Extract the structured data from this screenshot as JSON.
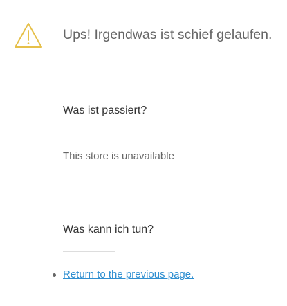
{
  "header": {
    "icon": "warning-icon",
    "title": "Ups! Irgendwas ist schief gelaufen."
  },
  "what_happened": {
    "heading": "Was ist passiert?",
    "text": "This store is unavailable"
  },
  "what_to_do": {
    "heading": "Was kann ich tun?",
    "actions": [
      {
        "label": "Return to the previous page."
      }
    ]
  },
  "colors": {
    "warning": "#e6c04a",
    "link": "#2f8fd1",
    "title_text": "#666666",
    "divider": "#dddddd"
  }
}
